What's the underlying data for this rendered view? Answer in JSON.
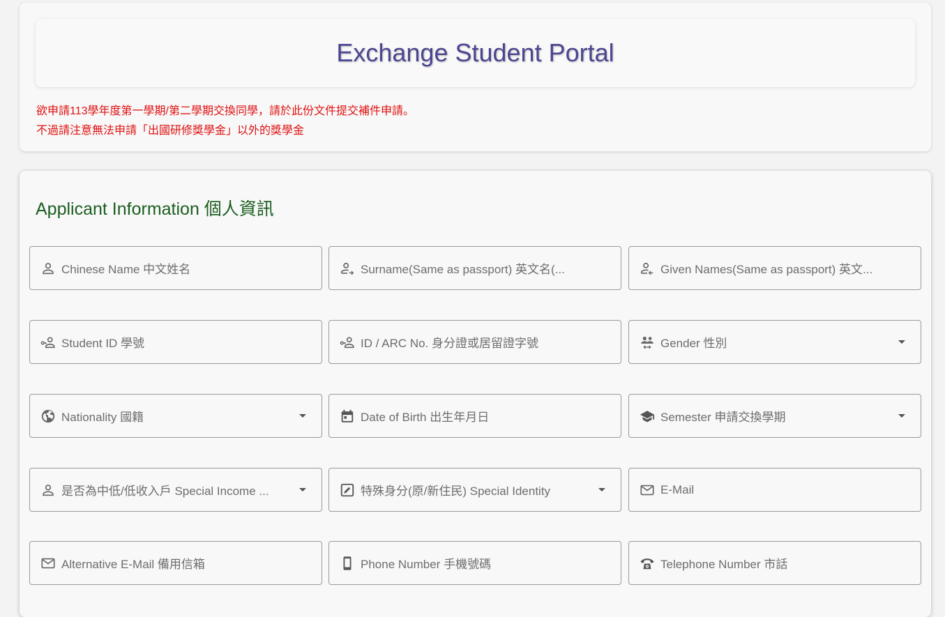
{
  "header": {
    "title": "Exchange Student Portal",
    "notice_line1": "欲申請113學年度第一學期/第二學期交換同學，請於此份文件提交補件申請。",
    "notice_line2": "不過請注意無法申請「出國研修獎學金」以外的獎學金"
  },
  "colors": {
    "title": "#4a4690",
    "notice": "#e01010",
    "section_title": "#1b5e20"
  },
  "form": {
    "section_title": "Applicant Information 個人資訊",
    "fields": [
      {
        "label": "Chinese Name 中文姓名",
        "icon": "person-icon",
        "type": "text"
      },
      {
        "label": "Surname(Same as passport) 英文名(...",
        "icon": "person-arrow-right-icon",
        "type": "text"
      },
      {
        "label": "Given Names(Same as passport) 英文...",
        "icon": "person-arrow-left-icon",
        "type": "text"
      },
      {
        "label": "Student ID 學號",
        "icon": "person-key-icon",
        "type": "text"
      },
      {
        "label": "ID / ARC No. 身分證或居留證字號",
        "icon": "person-key-icon",
        "type": "text"
      },
      {
        "label": "Gender 性別",
        "icon": "people-swap-icon",
        "type": "select"
      },
      {
        "label": "Nationality 國籍",
        "icon": "globe-icon",
        "type": "select"
      },
      {
        "label": "Date of Birth 出生年月日",
        "icon": "calendar-icon",
        "type": "text"
      },
      {
        "label": "Semester 申請交換學期",
        "icon": "school-icon",
        "type": "select"
      },
      {
        "label": "是否為中低/低收入戶 Special Income ...",
        "icon": "person-icon",
        "type": "select"
      },
      {
        "label": "特殊身分(原/新住民) Special Identity",
        "icon": "edit-box-icon",
        "type": "select"
      },
      {
        "label": "E-Mail",
        "icon": "mail-icon",
        "type": "text"
      },
      {
        "label": "Alternative E-Mail 備用信箱",
        "icon": "mail-icon",
        "type": "text"
      },
      {
        "label": "Phone Number 手機號碼",
        "icon": "cellphone-icon",
        "type": "text"
      },
      {
        "label": "Telephone Number 市話",
        "icon": "telephone-icon",
        "type": "text"
      }
    ]
  }
}
